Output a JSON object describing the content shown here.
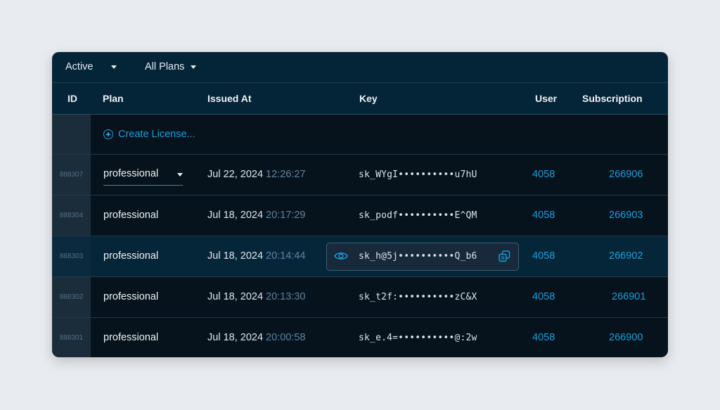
{
  "filters": {
    "status": "Active",
    "plans": "All Plans"
  },
  "columns": {
    "id": "ID",
    "plan": "Plan",
    "issued_at": "Issued At",
    "key": "Key",
    "user": "User",
    "subscription": "Subscription"
  },
  "create_label": "Create License...",
  "rows": [
    {
      "id": "888307",
      "plan": "professional",
      "date": "Jul 22, 2024",
      "time": "12:26:27",
      "key": "sk_WYgI••••••••••u7hU",
      "user": "4058",
      "subscription": "266906"
    },
    {
      "id": "888304",
      "plan": "professional",
      "date": "Jul 18, 2024",
      "time": "20:17:29",
      "key": "sk_podf••••••••••E^QM",
      "user": "4058",
      "subscription": "266903"
    },
    {
      "id": "888303",
      "plan": "professional",
      "date": "Jul 18, 2024",
      "time": "20:14:44",
      "key": "sk_h@5j••••••••••Q_b6",
      "user": "4058",
      "subscription": "266902"
    },
    {
      "id": "888302",
      "plan": "professional",
      "date": "Jul 18, 2024",
      "time": "20:13:30",
      "key": "sk_t2f:••••••••••zC&X",
      "user": "4058",
      "subscription": "266901"
    },
    {
      "id": "888301",
      "plan": "professional",
      "date": "Jul 18, 2024",
      "time": "20:00:58",
      "key": "sk_e.4=••••••••••@:2w",
      "user": "4058",
      "subscription": "266900"
    }
  ],
  "colors": {
    "accent": "#1b9ddb",
    "header_bg": "#042437",
    "body_bg": "#06131c",
    "selected_row_bg": "#052638"
  }
}
